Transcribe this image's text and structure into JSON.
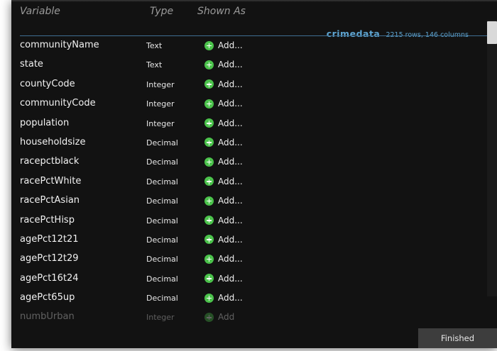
{
  "headers": {
    "variable": "Variable",
    "type": "Type",
    "shown_as": "Shown As"
  },
  "dataset": {
    "name": "crimedata",
    "info": "2215 rows, 146 columns"
  },
  "rows": [
    {
      "name": "communityName",
      "type": "Text",
      "action": "Add..."
    },
    {
      "name": "state",
      "type": "Text",
      "action": "Add..."
    },
    {
      "name": "countyCode",
      "type": "Integer",
      "action": "Add..."
    },
    {
      "name": "communityCode",
      "type": "Integer",
      "action": "Add..."
    },
    {
      "name": "population",
      "type": "Integer",
      "action": "Add..."
    },
    {
      "name": "householdsize",
      "type": "Decimal",
      "action": "Add..."
    },
    {
      "name": "racepctblack",
      "type": "Decimal",
      "action": "Add..."
    },
    {
      "name": "racePctWhite",
      "type": "Decimal",
      "action": "Add..."
    },
    {
      "name": "racePctAsian",
      "type": "Decimal",
      "action": "Add..."
    },
    {
      "name": "racePctHisp",
      "type": "Decimal",
      "action": "Add..."
    },
    {
      "name": "agePct12t21",
      "type": "Decimal",
      "action": "Add..."
    },
    {
      "name": "agePct12t29",
      "type": "Decimal",
      "action": "Add..."
    },
    {
      "name": "agePct16t24",
      "type": "Decimal",
      "action": "Add..."
    },
    {
      "name": "agePct65up",
      "type": "Decimal",
      "action": "Add..."
    },
    {
      "name": "numbUrban",
      "type": "Integer",
      "action": "Add"
    }
  ],
  "finished_label": "Finished",
  "colors": {
    "panel_bg": "#121212",
    "accent_blue": "#5ea4d0",
    "add_green": "#4cc34c"
  },
  "icons": {
    "add": "plus-circle-icon"
  }
}
